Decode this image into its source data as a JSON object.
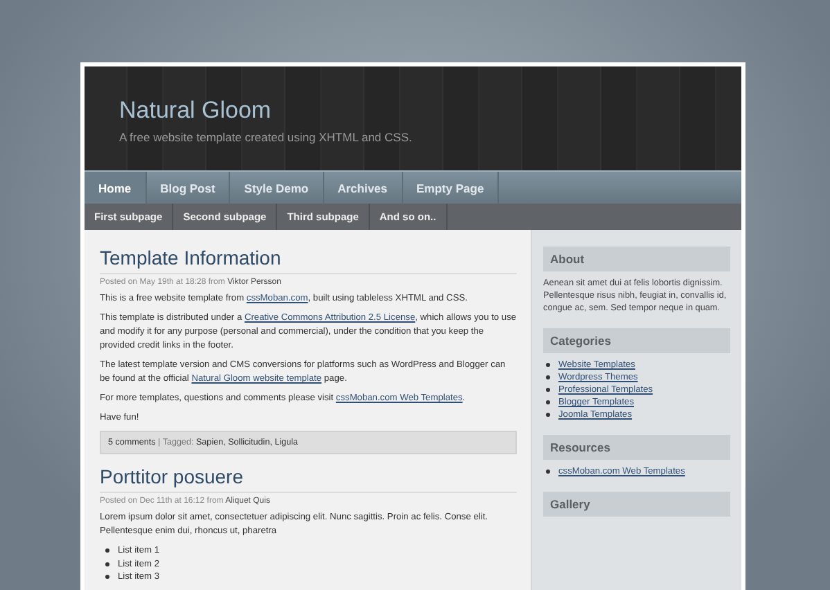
{
  "site": {
    "title": "Natural Gloom",
    "tagline": "A free website template created using XHTML and CSS."
  },
  "nav": [
    {
      "label": "Home",
      "selected": true
    },
    {
      "label": "Blog Post",
      "selected": false
    },
    {
      "label": "Style Demo",
      "selected": false
    },
    {
      "label": "Archives",
      "selected": false
    },
    {
      "label": "Empty Page",
      "selected": false
    }
  ],
  "subnav": [
    "First subpage",
    "Second subpage",
    "Third subpage",
    "And so on.."
  ],
  "posts": [
    {
      "title": "Template Information",
      "meta": "Posted on May 19th at 18:28 from **Viktor Persson**",
      "paragraphs": [
        [
          {
            "kind": "text",
            "text": "This is a free website template from "
          },
          {
            "kind": "link",
            "text": "cssMoban.com"
          },
          {
            "kind": "text",
            "text": ", built using tableless XHTML and CSS."
          }
        ],
        [
          {
            "kind": "text",
            "text": "This template is distributed under a "
          },
          {
            "kind": "link",
            "text": "Creative Commons Attribution 2.5 License"
          },
          {
            "kind": "text",
            "text": ", which allows you to use and modify it for any purpose (personal and commercial), under the condition that you keep the provided credit links in the footer."
          }
        ],
        [
          {
            "kind": "text",
            "text": "The latest template version and CMS conversions for platforms such as WordPress and Blogger can be found at the official "
          },
          {
            "kind": "link",
            "text": "Natural Gloom website template"
          },
          {
            "kind": "text",
            "text": " page."
          }
        ],
        [
          {
            "kind": "text",
            "text": "For more templates, questions and comments please visit "
          },
          {
            "kind": "link",
            "text": "cssMoban.com Web Templates"
          },
          {
            "kind": "text",
            "text": "."
          }
        ],
        [
          {
            "kind": "text",
            "text": "Have fun!"
          }
        ]
      ],
      "footer": "**5 comments** | Tagged: **Sapien, Sollicitudin, Ligula**"
    },
    {
      "title": "Porttitor posuere",
      "meta": "Posted on Dec 11th at 16:12 from **Aliquet Quis**",
      "paragraphs": [
        [
          {
            "kind": "text",
            "text": "Lorem ipsum dolor sit amet, consectetuer adipiscing elit. Nunc sagittis. Proin ac felis. Conse elit. Pellentesque enim dui, rhoncus ut, pharetra"
          }
        ]
      ],
      "list": [
        "List item 1",
        "List item 2",
        "List item 3"
      ]
    }
  ],
  "sidebar": [
    {
      "kind": "text",
      "heading": "About",
      "text": "Aenean sit amet dui at felis lobortis dignissim. Pellentesque risus nibh, feugiat in, convallis id, congue ac, sem. Sed tempor neque in quam."
    },
    {
      "kind": "links",
      "heading": "Categories",
      "items": [
        "Website Templates",
        "Wordpress Themes",
        "Professional Templates",
        "Blogger Templates",
        "Joomla Templates"
      ]
    },
    {
      "kind": "links",
      "heading": "Resources",
      "items": [
        "cssMoban.com Web Templates"
      ]
    },
    {
      "kind": "links",
      "heading": "Gallery"
    }
  ]
}
